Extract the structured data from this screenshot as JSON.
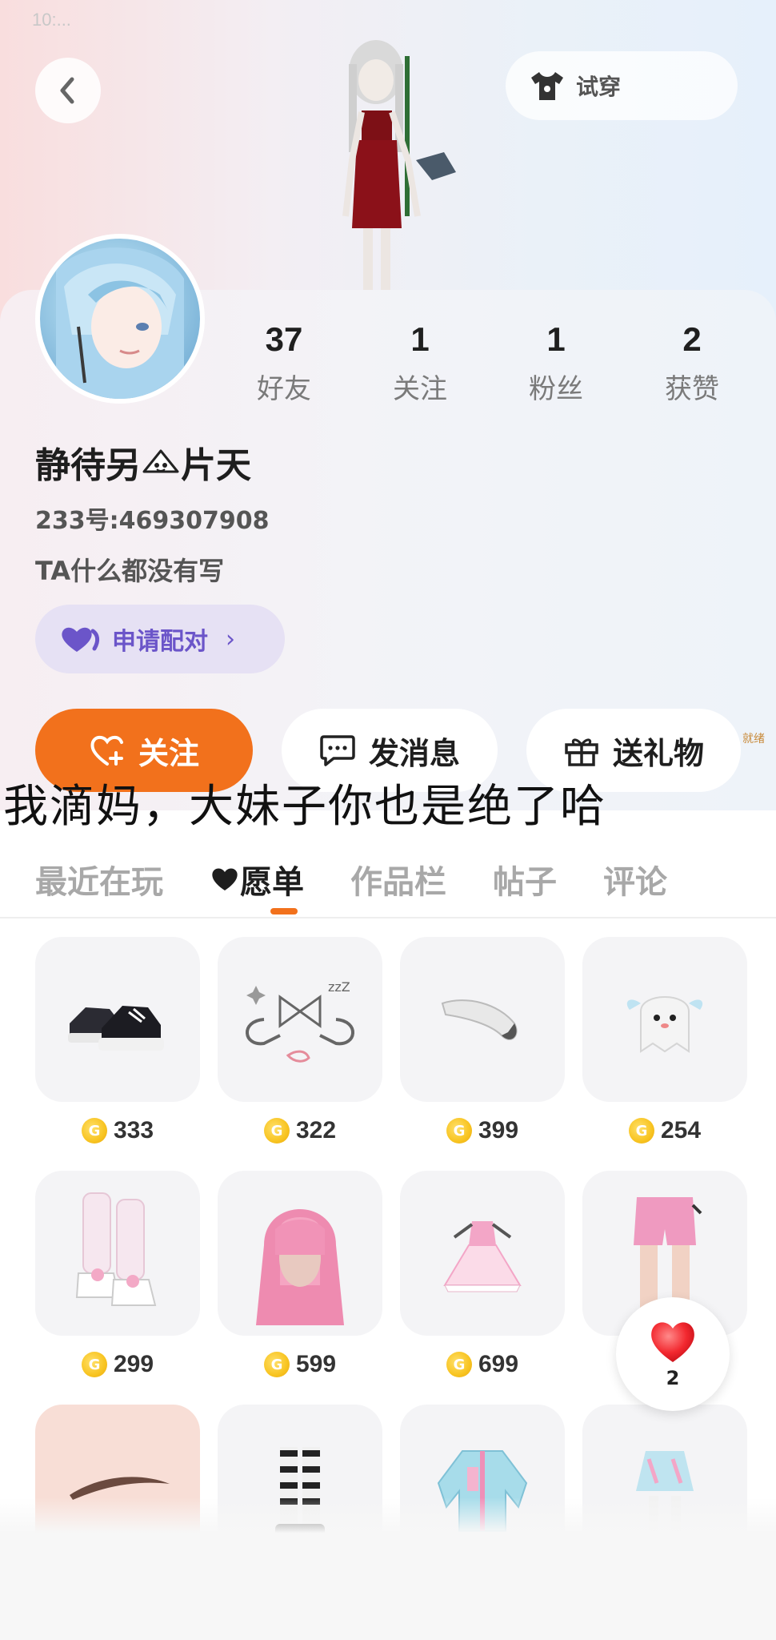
{
  "status_bar": {
    "time_faint": "10:..."
  },
  "header": {
    "try_on_label": "试穿"
  },
  "profile": {
    "stats": [
      {
        "value": "37",
        "label": "好友"
      },
      {
        "value": "1",
        "label": "关注"
      },
      {
        "value": "1",
        "label": "粉丝"
      },
      {
        "value": "2",
        "label": "获赞"
      }
    ],
    "username_part1": "静待另",
    "username_part2": "片天",
    "user_id": "233号:469307908",
    "bio": "TA什么都没有写",
    "pair_label": "申请配对",
    "follow_label": "关注",
    "message_label": "发消息",
    "gift_label": "送礼物",
    "mini_tag": "就绪"
  },
  "overlay_caption": "我滴妈，大妹子你也是绝了哈",
  "tabs": [
    {
      "label": "最近在玩"
    },
    {
      "label": "愿单"
    },
    {
      "label": "作品栏"
    },
    {
      "label": "帖子"
    },
    {
      "label": "评论"
    }
  ],
  "wishlist": {
    "items": [
      {
        "icon": "sneakers-icon",
        "price": "333"
      },
      {
        "icon": "bow-accessory-icon",
        "price": "322"
      },
      {
        "icon": "fur-tail-icon",
        "price": "399"
      },
      {
        "icon": "ghost-pet-icon",
        "price": "254"
      },
      {
        "icon": "leg-warmer-boots-icon",
        "price": "299"
      },
      {
        "icon": "pink-hair-icon",
        "price": "599"
      },
      {
        "icon": "pink-dress-icon",
        "price": "699"
      },
      {
        "icon": "pink-shorts-icon",
        "price": ""
      },
      {
        "icon": "eyebrow-icon",
        "price": ""
      },
      {
        "icon": "striped-socks-icon",
        "price": ""
      },
      {
        "icon": "jacket-icon",
        "price": ""
      },
      {
        "icon": "skirt-icon",
        "price": ""
      }
    ]
  },
  "like_button": {
    "count": "2"
  },
  "colors": {
    "accent_orange": "#f2711c",
    "pair_purple": "#6b55c9",
    "coin_gold": "#f8c421"
  }
}
